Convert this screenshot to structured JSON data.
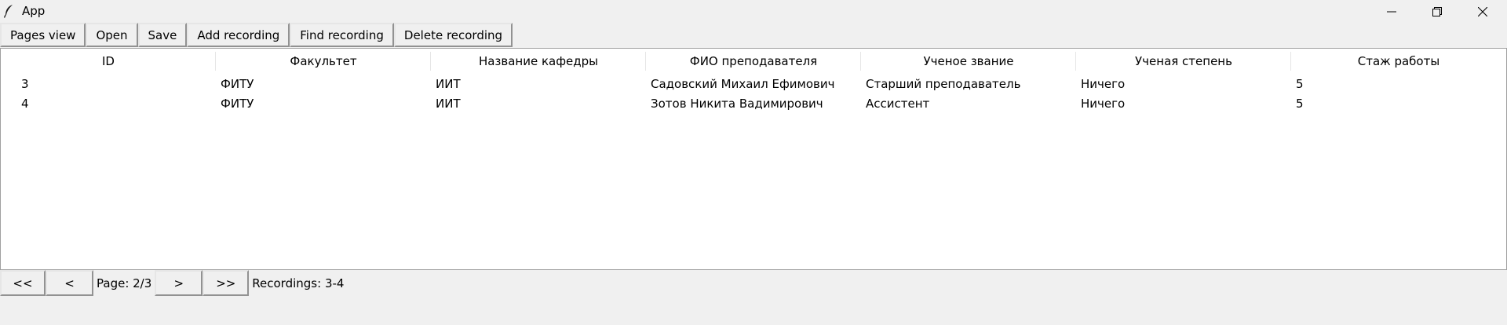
{
  "window": {
    "title": "App",
    "icon": "feather-icon",
    "controls": [
      "minimize-icon",
      "restore-icon",
      "close-icon"
    ]
  },
  "toolbar": {
    "pages_view": "Pages view",
    "open": "Open",
    "save": "Save",
    "add_recording": "Add recording",
    "find_recording": "Find recording",
    "delete_recording": "Delete recording"
  },
  "table": {
    "columns": [
      "ID",
      "Факультет",
      "Название кафедры",
      "ФИО преподавателя",
      "Ученое звание",
      "Ученая степень",
      "Стаж работы"
    ],
    "rows": [
      [
        "3",
        "ФИТУ",
        "ИИТ",
        "Садовский Михаил Ефимович",
        "Старший преподаватель",
        "Ничего",
        "5"
      ],
      [
        "4",
        "ФИТУ",
        "ИИТ",
        "Зотов Никита Вадимирович",
        "Ассистент",
        "Ничего",
        "5"
      ]
    ]
  },
  "pager": {
    "first": "<<",
    "prev": "<",
    "page_label": "Page: 2/3",
    "next": ">",
    "last": ">>",
    "recordings_label": "Recordings: 3-4"
  }
}
